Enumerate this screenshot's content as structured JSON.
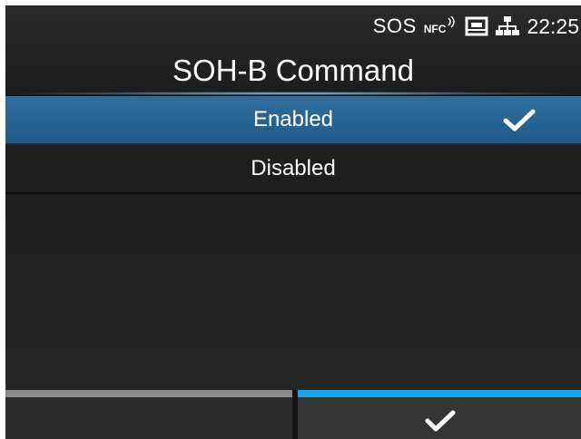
{
  "status": {
    "sos": "SOS",
    "nfc": "NFC",
    "time": "22:25"
  },
  "title": "SOH-B Command",
  "options": [
    {
      "label": "Enabled",
      "selected": true,
      "checked": true
    },
    {
      "label": "Disabled",
      "selected": false,
      "checked": false
    }
  ],
  "softkeys": {
    "left": {
      "label": "",
      "active": false
    },
    "right": {
      "icon": "checkmark-icon",
      "active": true
    }
  },
  "colors": {
    "background": "#141414",
    "selected_row": "#2a6594",
    "accent": "#1aa3e8",
    "inactive_softkey": "#8a8a8a"
  }
}
